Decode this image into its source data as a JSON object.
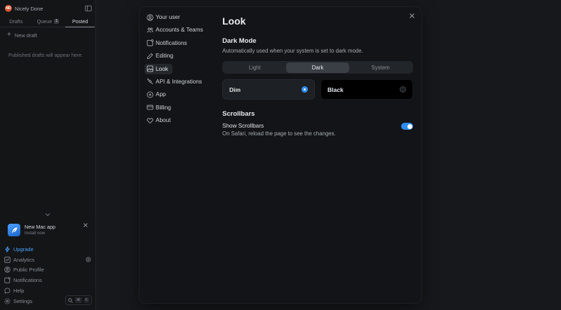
{
  "sidebar": {
    "avatar_initials": "ND",
    "account_name": "Nicely Done",
    "tabs": [
      {
        "label": "Drafts"
      },
      {
        "label": "Queue",
        "count": "1"
      },
      {
        "label": "Posted"
      }
    ],
    "active_tab": "Posted",
    "new_draft_label": "New draft",
    "empty_message": "Published drafts will appear here.",
    "promo": {
      "title": "New Mac app",
      "subtitle": "Install now"
    },
    "nav": [
      {
        "label": "Upgrade",
        "icon": "bolt-icon"
      },
      {
        "label": "Analytics",
        "icon": "chart-icon"
      },
      {
        "label": "Public Profile",
        "icon": "user-circle-icon"
      },
      {
        "label": "Notifications",
        "icon": "bell-icon"
      },
      {
        "label": "Help",
        "icon": "chat-bubble-icon"
      },
      {
        "label": "Settings",
        "icon": "gear-icon"
      }
    ],
    "search_shortcut": {
      "mod": "⌘",
      "key": "K"
    }
  },
  "modal": {
    "nav": [
      {
        "label": "Your user",
        "icon": "user-circle-icon"
      },
      {
        "label": "Accounts & Teams",
        "icon": "users-icon"
      },
      {
        "label": "Notifications",
        "icon": "notification-icon"
      },
      {
        "label": "Editing",
        "icon": "pencil-icon"
      },
      {
        "label": "Look",
        "icon": "image-icon"
      },
      {
        "label": "API & Integrations",
        "icon": "plug-icon"
      },
      {
        "label": "App",
        "icon": "plus-circle-icon"
      },
      {
        "label": "Billing",
        "icon": "credit-card-icon"
      },
      {
        "label": "About",
        "icon": "heart-icon"
      }
    ],
    "active_nav": "Look",
    "title": "Look",
    "dark_mode": {
      "title": "Dark Mode",
      "description": "Automatically used when your system is set to dark mode.",
      "options": [
        "Light",
        "Dark",
        "System"
      ],
      "selected": "Dark",
      "themes": [
        {
          "label": "Dim",
          "selected": true
        },
        {
          "label": "Black",
          "selected": false
        }
      ]
    },
    "scrollbars": {
      "title": "Scrollbars",
      "option_label": "Show Scrollbars",
      "option_desc": "On Safari, reload the page to see the changes.",
      "enabled": true
    }
  },
  "colors": {
    "accent": "#2e8cf0",
    "link": "#4aa3ff",
    "background": "#16181b",
    "modal": "#121417"
  }
}
